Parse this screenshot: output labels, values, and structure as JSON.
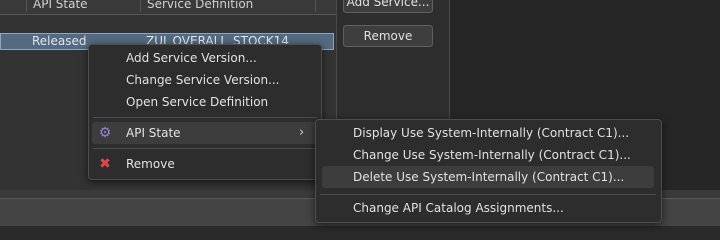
{
  "table": {
    "columns": [
      "API State",
      "Service Definition"
    ],
    "rows": [
      {
        "api_state": "Released",
        "service_definition": "ZUI_OVERALL_STOCK14"
      }
    ]
  },
  "buttons": {
    "add_service": "Add Service...",
    "remove": "Remove"
  },
  "context_menu": {
    "items": [
      {
        "label": "Add Service Version..."
      },
      {
        "label": "Change Service Version..."
      },
      {
        "label": "Open Service Definition"
      },
      {
        "label": "API State",
        "icon": "gear-icon",
        "has_submenu": true
      },
      {
        "label": "Remove",
        "icon": "close-icon"
      }
    ]
  },
  "submenu": {
    "items": [
      {
        "label": "Display Use System-Internally (Contract C1)..."
      },
      {
        "label": "Change Use System-Internally (Contract C1)..."
      },
      {
        "label": "Delete Use System-Internally (Contract C1)...",
        "hovered": true
      },
      {
        "label": "Change API Catalog Assignments..."
      }
    ]
  },
  "colors": {
    "accent_selection": "#556a80",
    "gear_icon": "#9b7fd4",
    "remove_icon": "#e0474c"
  }
}
